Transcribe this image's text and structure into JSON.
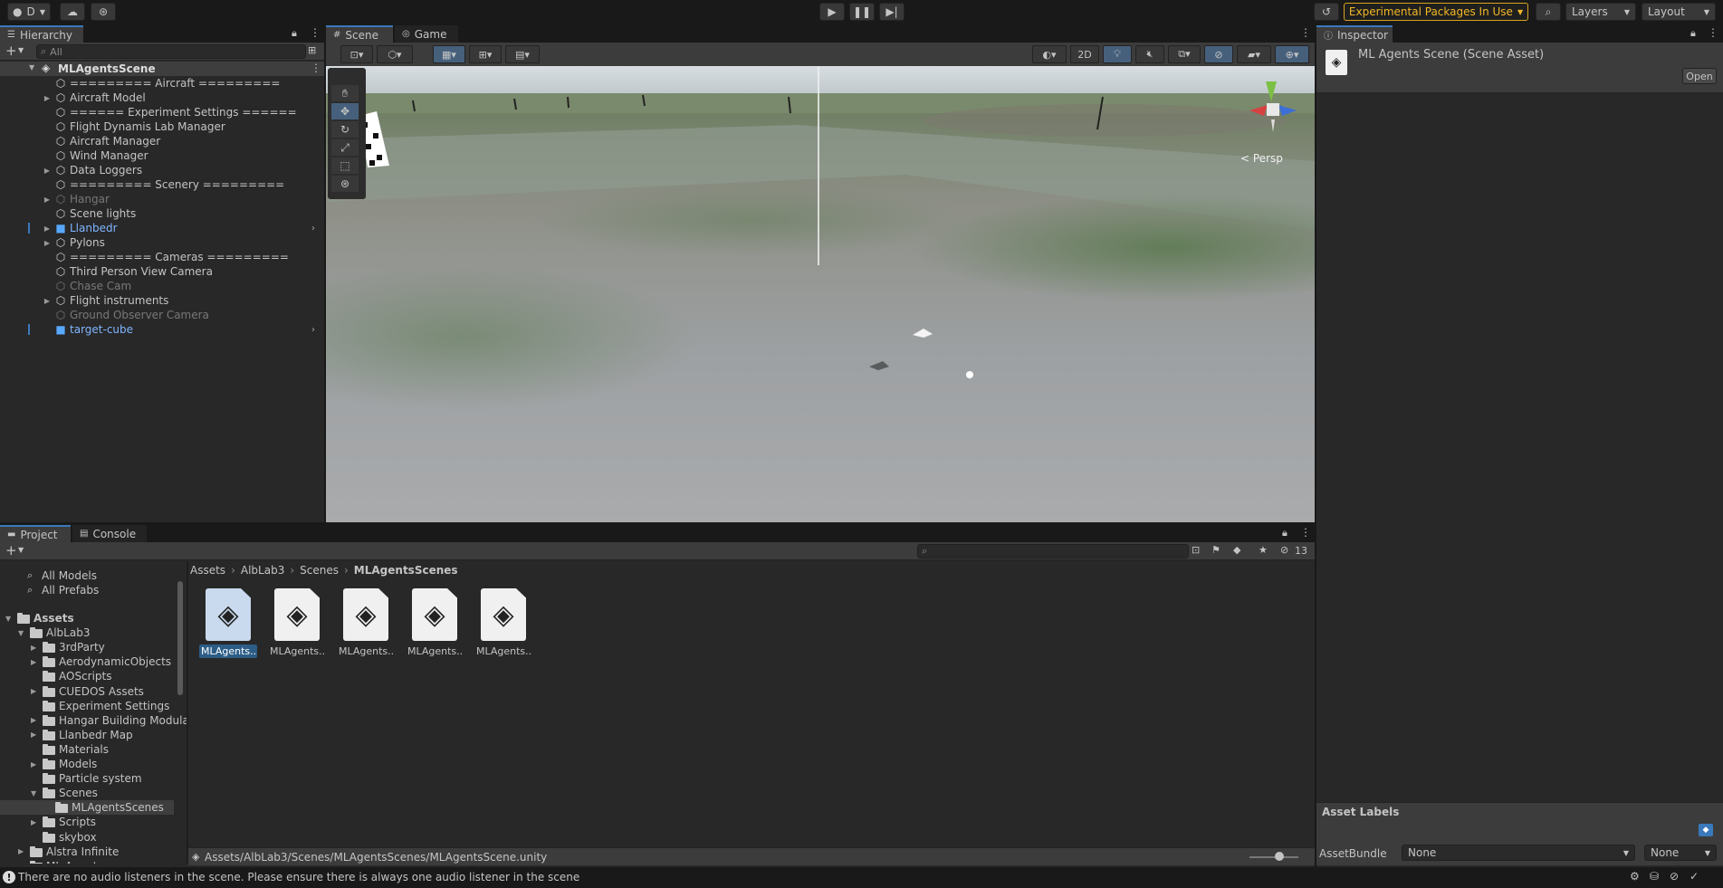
{
  "toolbar": {
    "account_label": "D",
    "experimental_label": "Experimental Packages In Use",
    "layers_label": "Layers",
    "layout_label": "Layout"
  },
  "hierarchy": {
    "tab_label": "Hierarchy",
    "search_placeholder": "All",
    "scene_name": "MLAgentsScene",
    "rows": [
      {
        "label": "========= Aircraft =========",
        "style": "normal",
        "expandable": false,
        "prefab": false
      },
      {
        "label": "Aircraft Model",
        "style": "normal",
        "expandable": true,
        "prefab": false
      },
      {
        "label": "====== Experiment Settings ======",
        "style": "normal",
        "expandable": false,
        "prefab": false
      },
      {
        "label": "Flight Dynamis Lab Manager",
        "style": "normal",
        "expandable": false,
        "prefab": false
      },
      {
        "label": "Aircraft Manager",
        "style": "normal",
        "expandable": false,
        "prefab": false
      },
      {
        "label": "Wind Manager",
        "style": "normal",
        "expandable": false,
        "prefab": false
      },
      {
        "label": "Data Loggers",
        "style": "normal",
        "expandable": true,
        "prefab": false
      },
      {
        "label": "========= Scenery =========",
        "style": "normal",
        "expandable": false,
        "prefab": false
      },
      {
        "label": "Hangar",
        "style": "dim",
        "expandable": true,
        "prefab": false
      },
      {
        "label": "Scene lights",
        "style": "normal",
        "expandable": false,
        "prefab": false
      },
      {
        "label": "Llanbedr",
        "style": "blue",
        "expandable": true,
        "prefab": true
      },
      {
        "label": "Pylons",
        "style": "normal",
        "expandable": true,
        "prefab": false
      },
      {
        "label": "========= Cameras =========",
        "style": "normal",
        "expandable": false,
        "prefab": false
      },
      {
        "label": "Third Person View Camera",
        "style": "normal",
        "expandable": false,
        "prefab": false
      },
      {
        "label": "Chase Cam",
        "style": "dim",
        "expandable": false,
        "prefab": false
      },
      {
        "label": "Flight instruments",
        "style": "normal",
        "expandable": true,
        "prefab": false
      },
      {
        "label": "Ground Observer Camera",
        "style": "dim",
        "expandable": false,
        "prefab": false
      },
      {
        "label": "target-cube",
        "style": "blue",
        "expandable": false,
        "prefab": true
      }
    ]
  },
  "scene": {
    "tab_scene": "Scene",
    "tab_game": "Game",
    "btn_2d": "2D",
    "persp_label": "< Persp"
  },
  "inspector": {
    "tab_label": "Inspector",
    "title": "ML Agents Scene (Scene Asset)",
    "open_label": "Open",
    "asset_labels": "Asset Labels",
    "assetbundle_label": "AssetBundle",
    "assetbundle_value": "None",
    "variant_value": "None"
  },
  "project": {
    "tab_project": "Project",
    "tab_console": "Console",
    "hidden_count": "13",
    "breadcrumb": [
      "Assets",
      "AlbLab3",
      "Scenes",
      "MLAgentsScenes"
    ],
    "favorites": [
      "All Models",
      "All Prefabs"
    ],
    "tree": [
      {
        "label": "Assets",
        "depth": 0,
        "expanded": true,
        "bold": true
      },
      {
        "label": "AlbLab3",
        "depth": 1,
        "expanded": true
      },
      {
        "label": "3rdParty",
        "depth": 2,
        "expandable": true
      },
      {
        "label": "AerodynamicObjects",
        "depth": 2,
        "expandable": true
      },
      {
        "label": "AOScripts",
        "depth": 2
      },
      {
        "label": "CUEDOS Assets",
        "depth": 2,
        "expandable": true
      },
      {
        "label": "Experiment Settings",
        "depth": 2
      },
      {
        "label": "Hangar Building Modula",
        "depth": 2,
        "expandable": true
      },
      {
        "label": "Llanbedr Map",
        "depth": 2,
        "expandable": true
      },
      {
        "label": "Materials",
        "depth": 2
      },
      {
        "label": "Models",
        "depth": 2,
        "expandable": true
      },
      {
        "label": "Particle system",
        "depth": 2
      },
      {
        "label": "Scenes",
        "depth": 2,
        "expanded": true
      },
      {
        "label": "MLAgentsScenes",
        "depth": 3,
        "selected": true
      },
      {
        "label": "Scripts",
        "depth": 2,
        "expandable": true
      },
      {
        "label": "skybox",
        "depth": 2
      },
      {
        "label": "Alstra Infinite",
        "depth": 1,
        "expandable": true
      },
      {
        "label": "ML-Agents",
        "depth": 1,
        "expandable": true
      }
    ],
    "assets": [
      "MLAgents...",
      "MLAgents...",
      "MLAgents...",
      "MLAgents...",
      "MLAgents..."
    ],
    "path": "Assets/AlbLab3/Scenes/MLAgentsScenes/MLAgentsScene.unity"
  },
  "status": {
    "message": "There are no audio listeners in the scene. Please ensure there is always one audio listener in the scene"
  },
  "colors": {
    "accent": "#3a79bb",
    "warning": "#f2b724",
    "prefab": "#7fb5ff"
  }
}
